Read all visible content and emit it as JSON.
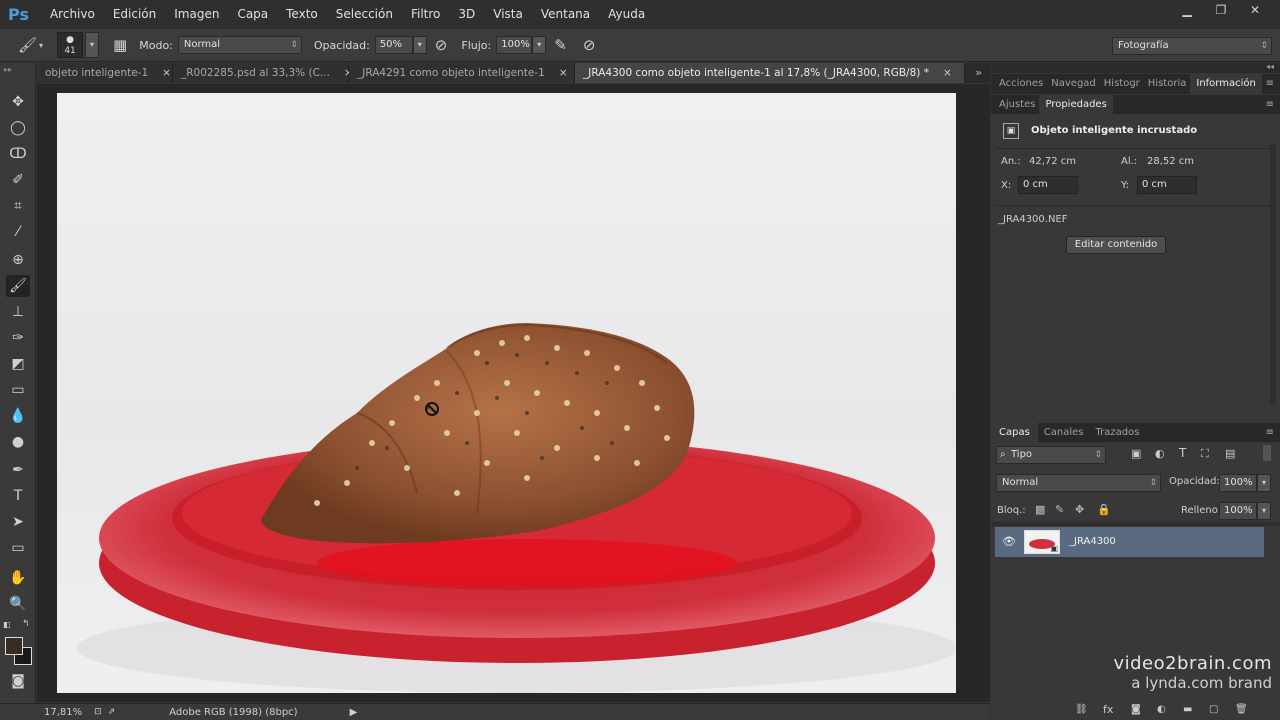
{
  "app": {
    "logo": "Ps"
  },
  "menu": [
    "Archivo",
    "Edición",
    "Imagen",
    "Capa",
    "Texto",
    "Selección",
    "Filtro",
    "3D",
    "Vista",
    "Ventana",
    "Ayuda"
  ],
  "options": {
    "brush_size": "41",
    "mode_label": "Modo:",
    "mode_value": "Normal",
    "opacity_label": "Opacidad:",
    "opacity_value": "50%",
    "flow_label": "Flujo:",
    "flow_value": "100%",
    "workspace": "Fotografía"
  },
  "tabs": [
    {
      "label": "objeto inteligente-1",
      "close": "×"
    },
    {
      "label": "_R002285.psd al 33,3% (C...",
      "close": "×"
    },
    {
      "label": "_JRA4291 como objeto inteligente-1",
      "close": "×"
    },
    {
      "label": "_JRA4300 como objeto inteligente-1 al 17,8% (_JRA4300, RGB/8) *",
      "close": "×"
    }
  ],
  "tabs_overflow": "»",
  "panels_top": {
    "tabs": [
      "Acciones",
      "Navegad",
      "Histogr",
      "Historia",
      "Información"
    ],
    "active": "Información"
  },
  "panels_props": {
    "tabs": [
      "Ajustes",
      "Propiedades"
    ],
    "title": "Objeto inteligente incrustado",
    "w_label": "An.:",
    "w_value": "42,72 cm",
    "h_label": "Al.:",
    "h_value": "28,52 cm",
    "x_label": "X:",
    "x_value": "0 cm",
    "y_label": "Y:",
    "y_value": "0 cm",
    "filename": "_JRA4300.NEF",
    "edit_button": "Editar contenido"
  },
  "layers": {
    "tabs": [
      "Capas",
      "Canales",
      "Trazados"
    ],
    "filter_value": "Tipo",
    "blend_value": "Normal",
    "opacity_label": "Opacidad:",
    "opacity_value": "100%",
    "lock_label": "Bloq.:",
    "fill_label": "Relleno:",
    "fill_value": "100%",
    "layer_name": "_JRA4300"
  },
  "status": {
    "zoom": "17,81%",
    "profile": "Adobe RGB (1998) (8bpc)"
  },
  "watermark": {
    "line1": "video2brain.com",
    "line2": "a lynda.com brand"
  },
  "colors": {
    "accent": "#4a9cdf",
    "selected_layer": "#5a6a80",
    "plate": "#d9323e"
  }
}
